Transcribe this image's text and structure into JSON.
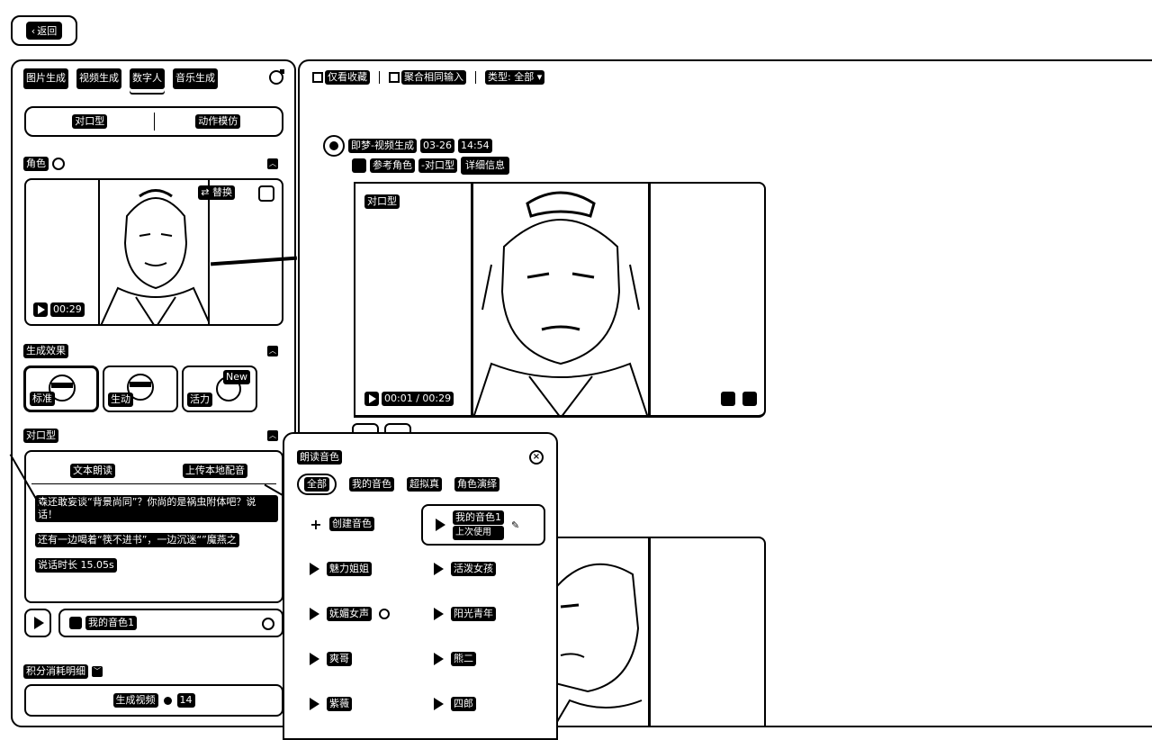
{
  "back_button": {
    "label": "返回"
  },
  "left": {
    "tabs": [
      "图片生成",
      "视频生成",
      "数字人",
      "音乐生成"
    ],
    "active_tab": "数字人",
    "mode_options": [
      "对口型",
      "动作模仿"
    ],
    "role_section": {
      "title": "角色",
      "replace_label": "替换",
      "duration": "00:29"
    },
    "effect_section": {
      "title": "生成效果",
      "options": [
        "标准",
        "生动",
        "活力"
      ],
      "new_badge": "New"
    },
    "dialog_section": {
      "title": "对口型",
      "tabs": [
        "文本朗读",
        "上传本地配音"
      ],
      "line1": "森还敢妄谈“背景尚同”？你尚的是祸虫附体吧？说话！",
      "line2": "还有一边喝着“筷不进书”，一边沉迷“”魔燕之",
      "duration_text": "说话时长 15.05s"
    },
    "voice": {
      "name": "我的音色1"
    },
    "points_label": "积分消耗明细",
    "generate": {
      "label": "生成视频",
      "cost": "14"
    }
  },
  "right": {
    "filters": {
      "favorites": "仅看收藏",
      "merge": "聚合相同输入",
      "type_label": "类型: 全部"
    },
    "task": {
      "source": "即梦-视频生成",
      "date": "03-26",
      "time": "14:54",
      "ref_label": "参考角色",
      "mode": "-对口型",
      "detail_button": "详细信息"
    },
    "video": {
      "mode_badge": "对口型",
      "time": "00:01 / 00:29"
    }
  },
  "voice_popup": {
    "title": "朗读音色",
    "tabs": [
      "全部",
      "我的音色",
      "超拟真",
      "角色演绎"
    ],
    "create_label": "创建音色",
    "my_voice": {
      "name": "我的音色1",
      "sub": "上次使用"
    },
    "voices": [
      "魅力姐姐",
      "活泼女孩",
      "妩媚女声",
      "阳光青年",
      "爽哥",
      "熊二",
      "紫薇",
      "四郎"
    ]
  }
}
